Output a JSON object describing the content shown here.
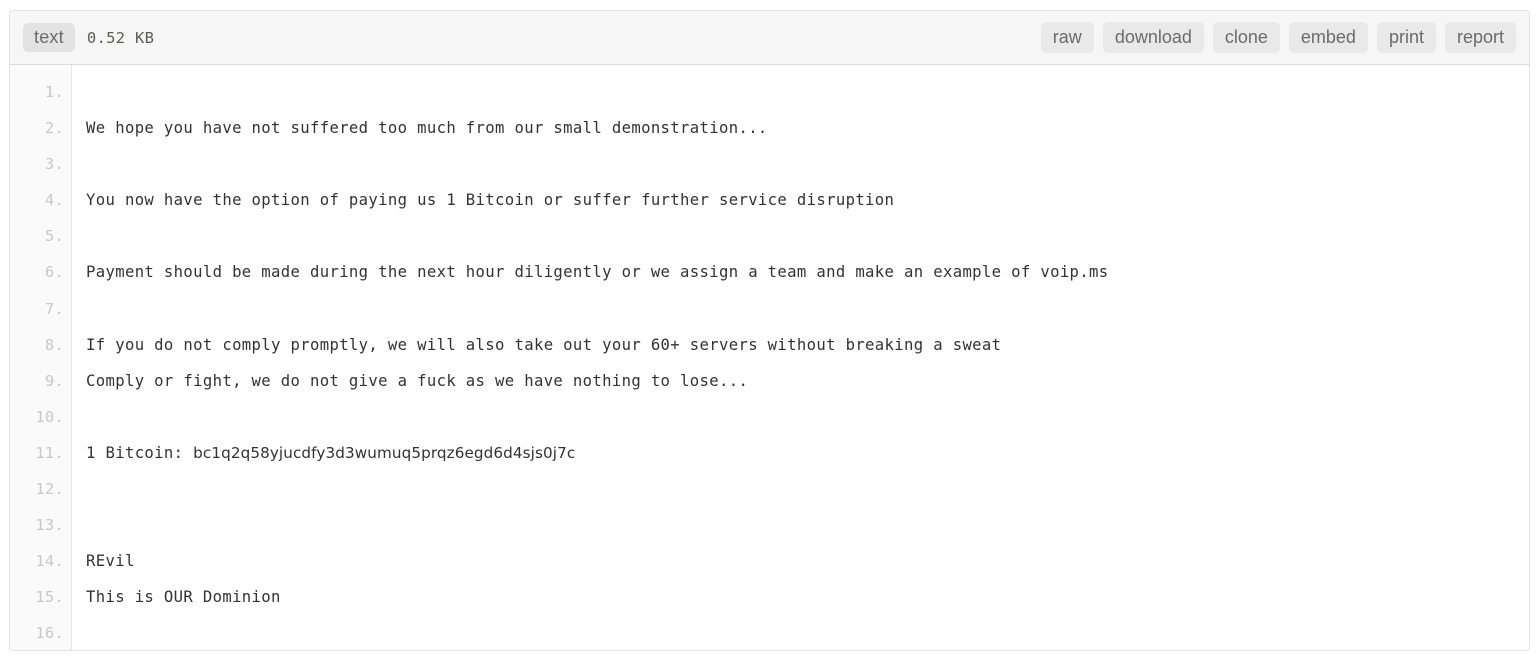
{
  "toolbar": {
    "type_badge": "text",
    "file_size": "0.52 KB",
    "actions": [
      {
        "name": "raw",
        "label": "raw"
      },
      {
        "name": "download",
        "label": "download"
      },
      {
        "name": "clone",
        "label": "clone"
      },
      {
        "name": "embed",
        "label": "embed"
      },
      {
        "name": "print",
        "label": "print"
      },
      {
        "name": "report",
        "label": "report"
      }
    ]
  },
  "editor": {
    "line_numbers": [
      "1.",
      "2.",
      "3.",
      "4.",
      "5.",
      "6.",
      "7.",
      "8.",
      "9.",
      "10.",
      "11.",
      "12.",
      "13.",
      "14.",
      "15.",
      "16."
    ],
    "lines": [
      "",
      "We hope you have not suffered too much from our small demonstration...",
      "",
      "You now have the option of paying us 1 Bitcoin or suffer further service disruption",
      "",
      "Payment should be made during the next hour diligently or we assign a team and make an example of voip.ms",
      "",
      "If you do not comply promptly, we will also take out your 60+ servers without breaking a sweat",
      "Comply or fight, we do not give a fuck as we have nothing to lose...",
      "",
      "1 Bitcoin: bc1q2q58yjucdfy3d3wumuq5prqz6egd6d4sjs0j7c",
      "",
      "",
      "REvil",
      "This is OUR Dominion",
      ""
    ],
    "bitcoin_label": "1 Bitcoin: ",
    "bitcoin_address": "bc1q2q58yjucdfy3d3wumuq5prqz6egd6d4sjs0j7c"
  },
  "colors": {
    "toolbar_bg": "#f6f6f6",
    "badge_bg": "#e3e3e3",
    "button_bg": "#e9e9e9",
    "button_text": "#6b6b6b",
    "gutter_bg": "#fafafa",
    "line_number": "#c8c8c8",
    "code_text": "#333333",
    "border": "#e3e3e3"
  }
}
